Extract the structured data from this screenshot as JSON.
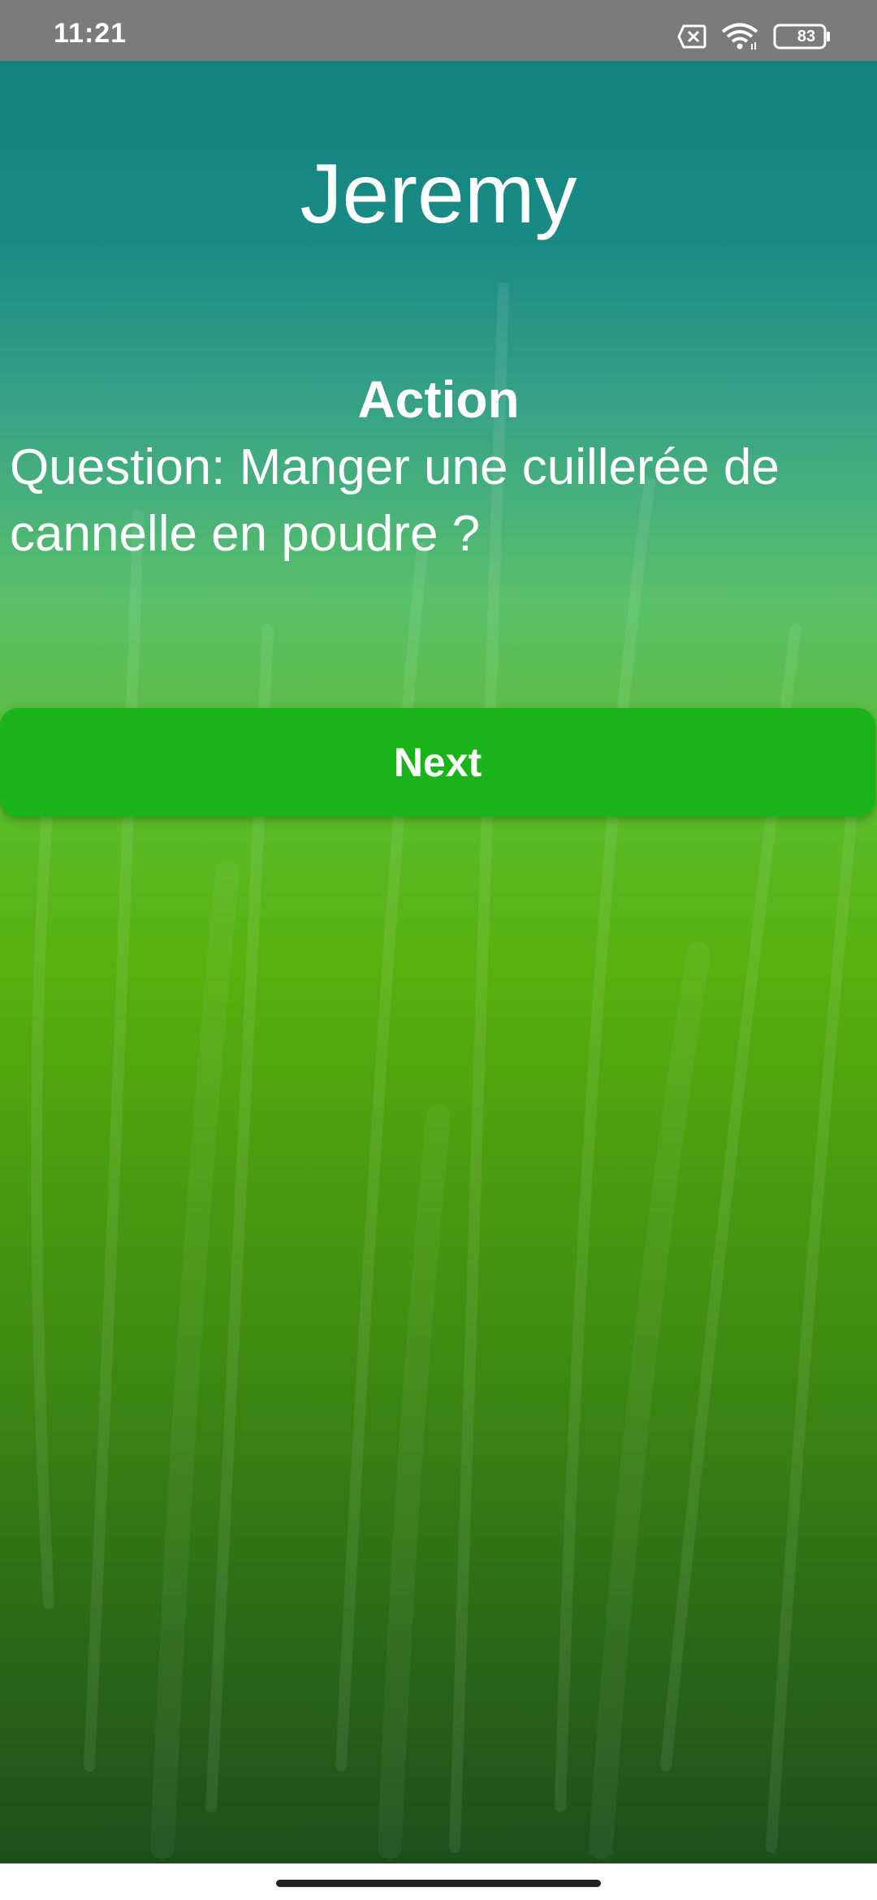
{
  "status_bar": {
    "time": "11:21",
    "battery_level": "83",
    "icons": [
      "sim-off-icon",
      "wifi-icon",
      "battery-icon"
    ]
  },
  "game": {
    "player_name": "Jeremy",
    "question_type": "Action",
    "question_text": "Question: Manger une cuillerée de cannelle en poudre ?",
    "next_label": "Next"
  },
  "colors": {
    "status_bar": "#7b7b7b",
    "button": "#1ab41a",
    "background_top": "#0f837c",
    "background_bottom": "#1c4e1b"
  }
}
